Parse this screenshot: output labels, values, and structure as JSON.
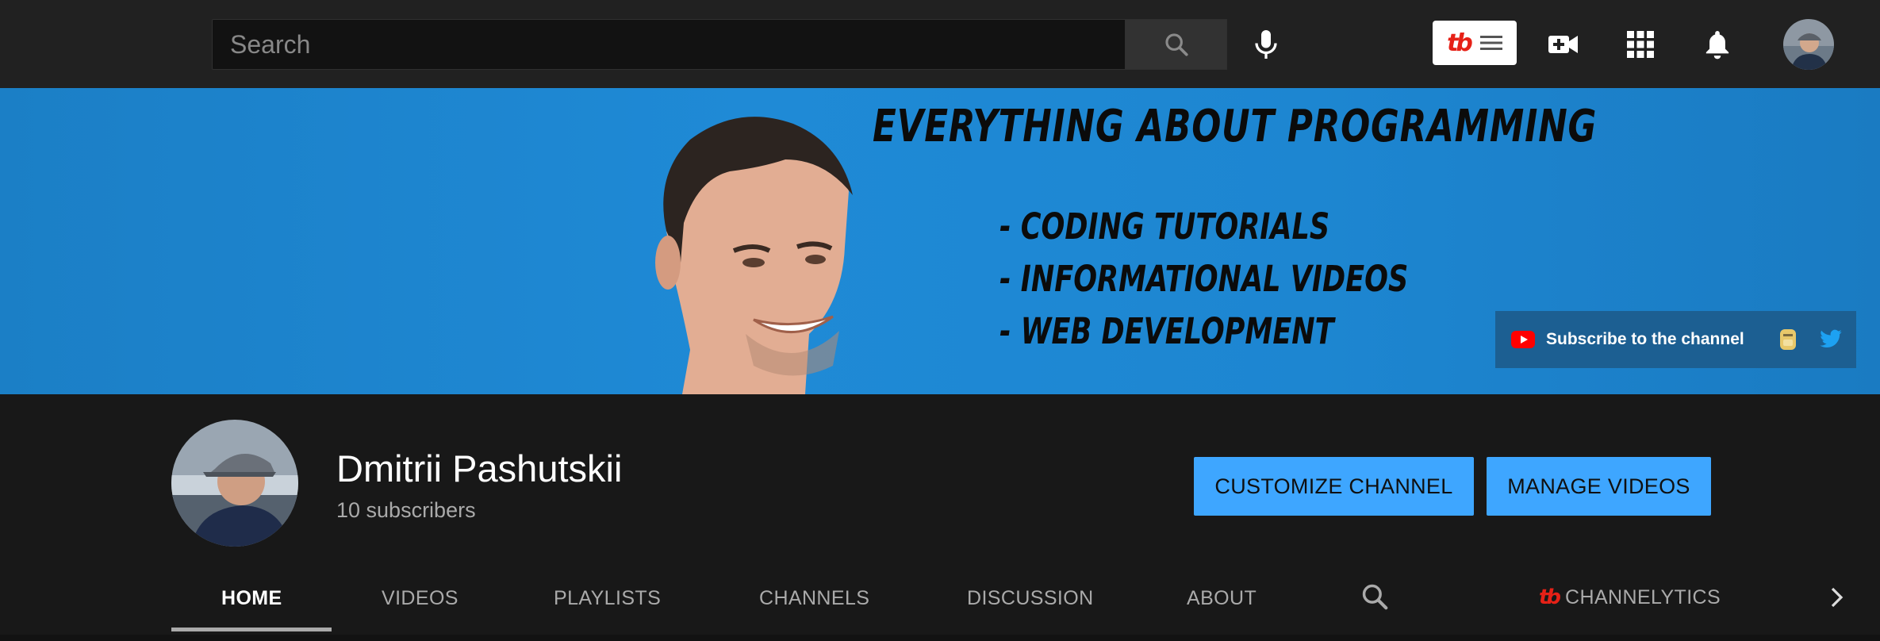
{
  "header": {
    "search_placeholder": "Search",
    "tubebuddy_logo": "tb"
  },
  "banner": {
    "title": "EVERYTHING ABOUT PROGRAMMING",
    "lines": [
      "- CODING TUTORIALS",
      "- INFORMATIONAL VIDEOS",
      "- WEB DEVELOPMENT"
    ],
    "links": {
      "subscribe_label": "Subscribe to the channel"
    }
  },
  "channel": {
    "name": "Dmitrii Pashutskii",
    "subscribers": "10 subscribers",
    "customize_label": "CUSTOMIZE CHANNEL",
    "manage_label": "MANAGE VIDEOS"
  },
  "tabs": [
    {
      "label": "HOME",
      "active": true
    },
    {
      "label": "VIDEOS"
    },
    {
      "label": "PLAYLISTS"
    },
    {
      "label": "CHANNELS"
    },
    {
      "label": "DISCUSSION"
    },
    {
      "label": "ABOUT"
    }
  ],
  "channelytics": {
    "logo": "tb",
    "label": "CHANNELYTICS"
  },
  "colors": {
    "accent_button": "#3ea6ff",
    "banner_blue": "#1f8ad6",
    "youtube_red": "#ff0000",
    "twitter_blue": "#1da1f2"
  },
  "icons": [
    "search-icon",
    "mic-icon",
    "menu-icon",
    "create-video-icon",
    "apps-grid-icon",
    "notifications-bell-icon",
    "youtube-logo-icon",
    "twitter-icon",
    "chevron-right-icon"
  ]
}
